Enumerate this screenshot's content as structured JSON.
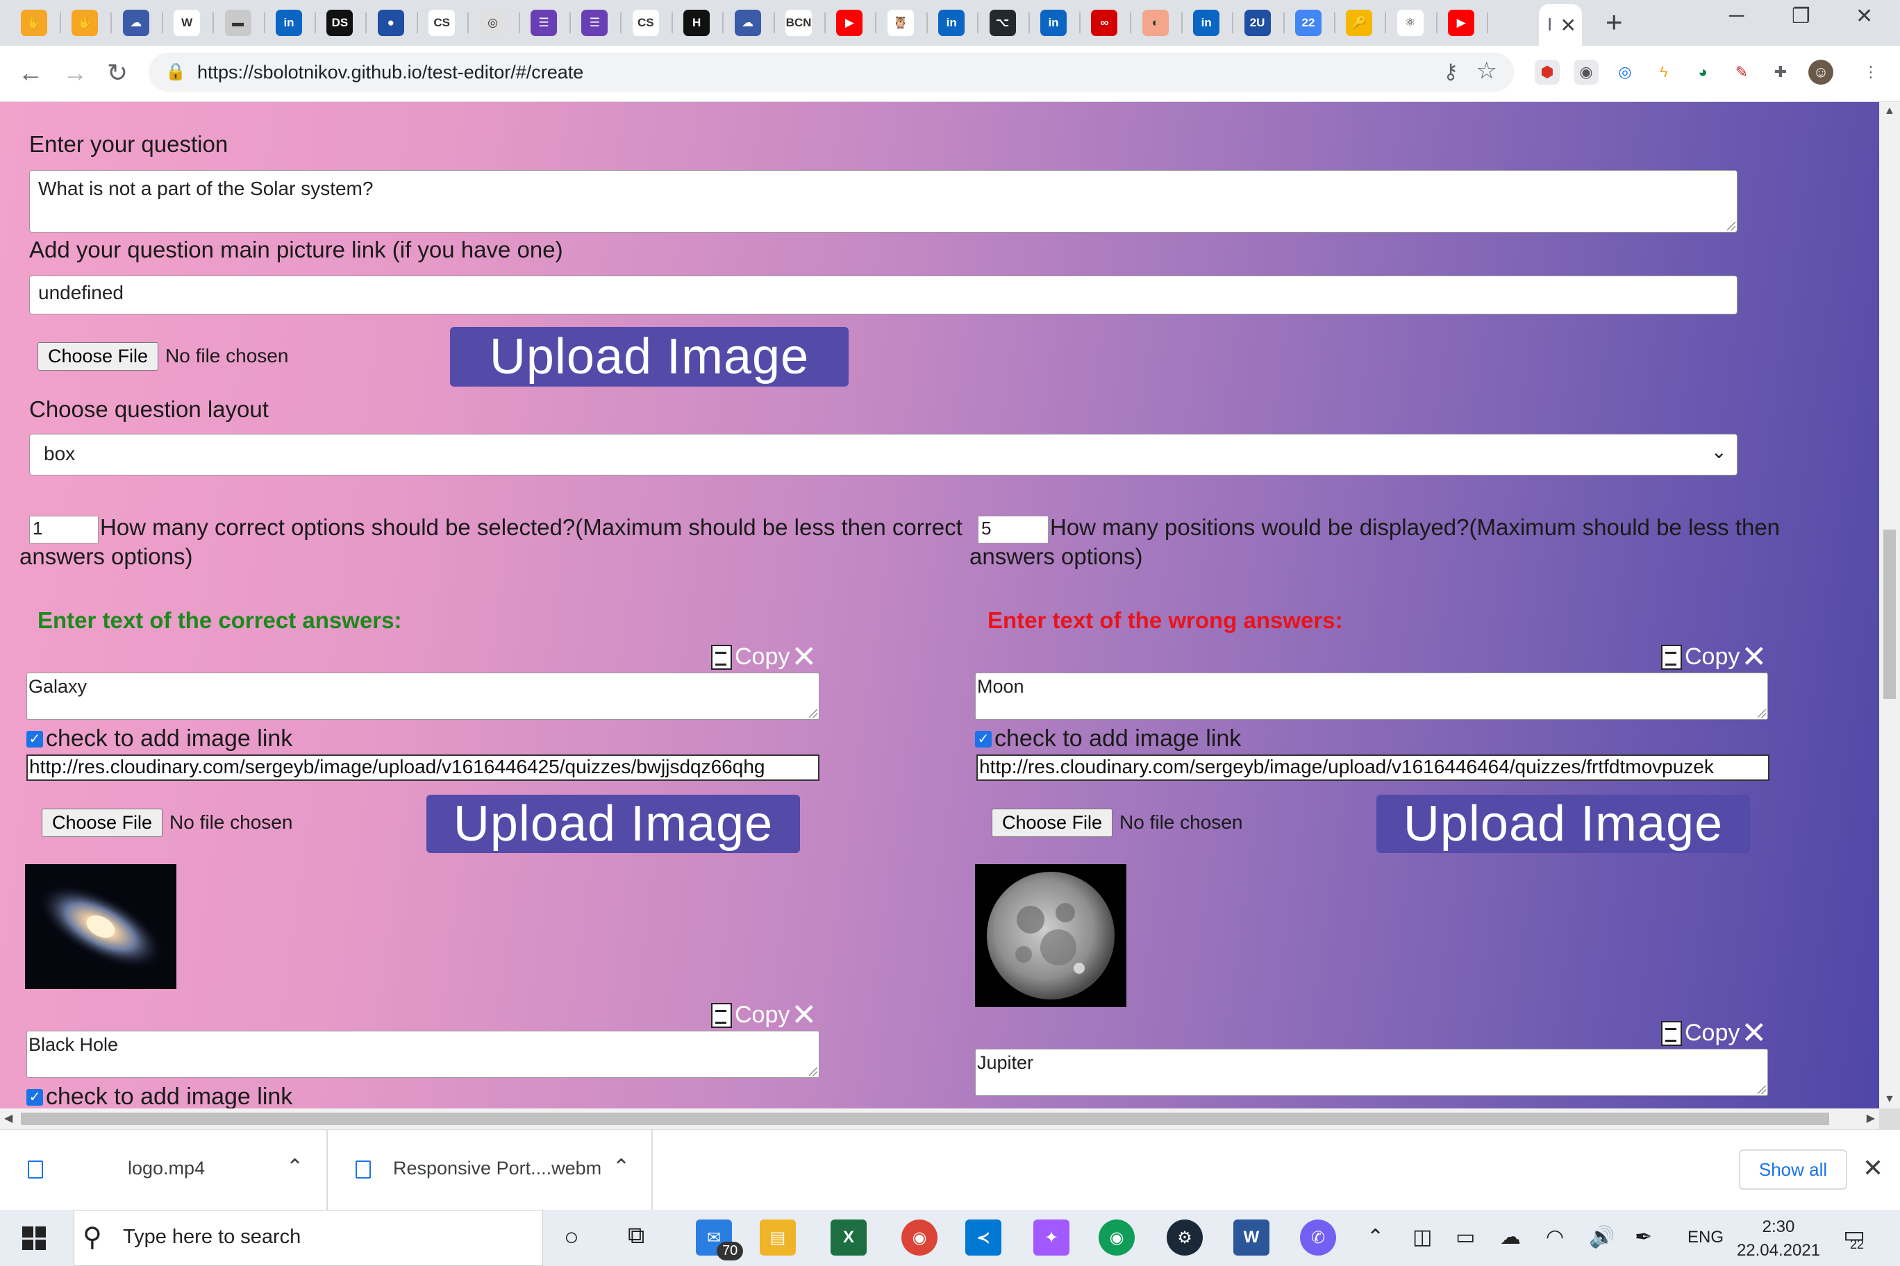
{
  "browser": {
    "tab_icons": [
      {
        "icon": "hand-icon",
        "color": "#f5a623",
        "text": "✋"
      },
      {
        "icon": "hand-icon",
        "color": "#f5a623",
        "text": "✋"
      },
      {
        "icon": "cloud-icon",
        "color": "#3b5ba9",
        "text": "☁"
      },
      {
        "icon": "wikipedia-icon",
        "color": "#ffffff",
        "text": "W"
      },
      {
        "icon": "page-icon",
        "color": "#c9c9c9",
        "text": "▬"
      },
      {
        "icon": "linkedin-icon",
        "color": "#0a66c2",
        "text": "in"
      },
      {
        "icon": "ds-icon",
        "color": "#111111",
        "text": "DS"
      },
      {
        "icon": "circle-icon",
        "color": "#1f4ea3",
        "text": "●"
      },
      {
        "icon": "cs-icon",
        "color": "#ffffff",
        "text": "CS"
      },
      {
        "icon": "badge-icon",
        "color": "#e0e0e0",
        "text": "◎"
      },
      {
        "icon": "list-icon",
        "color": "#6a3fb5",
        "text": "☰"
      },
      {
        "icon": "list-icon",
        "color": "#6a3fb5",
        "text": "☰"
      },
      {
        "icon": "cs-icon",
        "color": "#ffffff",
        "text": "CS"
      },
      {
        "icon": "h-icon",
        "color": "#111111",
        "text": "H"
      },
      {
        "icon": "cloud-icon",
        "color": "#3b5ba9",
        "text": "☁"
      },
      {
        "icon": "bcn-icon",
        "color": "#ffffff",
        "text": "BCN"
      },
      {
        "icon": "youtube-icon",
        "color": "#ff0000",
        "text": "▶"
      },
      {
        "icon": "owl-icon",
        "color": "#ffffff",
        "text": "🦉"
      },
      {
        "icon": "linkedin-icon",
        "color": "#0a66c2",
        "text": "in"
      },
      {
        "icon": "github-icon",
        "color": "#24292e",
        "text": "⌥"
      },
      {
        "icon": "linkedin-icon",
        "color": "#0a66c2",
        "text": "in"
      },
      {
        "icon": "codewars-icon",
        "color": "#d40000",
        "text": "∞"
      },
      {
        "icon": "app-icon",
        "color": "#f4a58a",
        "text": "◐"
      },
      {
        "icon": "linkedin-icon",
        "color": "#0a66c2",
        "text": "in"
      },
      {
        "icon": "2u-icon",
        "color": "#1f4ea3",
        "text": "2U"
      },
      {
        "icon": "calendar-icon",
        "color": "#4285f4",
        "text": "22"
      },
      {
        "icon": "key-icon",
        "color": "#f5b700",
        "text": "🔑"
      },
      {
        "icon": "react-icon",
        "color": "#ffffff",
        "text": "⚛"
      },
      {
        "icon": "youtube-icon",
        "color": "#ff0000",
        "text": "▶"
      }
    ],
    "active_tab_text": "I",
    "url": "https://sbolotnikov.github.io/test-editor/#/create"
  },
  "form": {
    "question_label": "Enter your question",
    "question_value": "What is not a part of the Solar system?",
    "picture_label": "Add your question main picture link (if you have one)",
    "picture_value": "undefined",
    "choose_file": "Choose File",
    "no_file": "No file chosen",
    "upload_label": "Upload Image",
    "layout_label": "Choose question layout",
    "layout_value": "box",
    "correct_count": "1",
    "correct_count_text": "How many correct options should be selected?(Maximum should be less then correct answers options)",
    "positions_count": "5",
    "positions_count_text": "How many positions would be displayed?(Maximum should be less then answers options)"
  },
  "correct": {
    "heading": "Enter text of the correct answers:",
    "heading_color": "#1a8a1a",
    "copy_label": "Copy",
    "answers": [
      {
        "text": "Galaxy",
        "checkbox_label": "check to add image link",
        "link": "http://res.cloudinary.com/sergeyb/image/upload/v1616446425/quizzes/bwjjsdqz66qhg"
      },
      {
        "text": "Black Hole",
        "checkbox_label": "check to add image link"
      }
    ]
  },
  "wrong": {
    "heading": "Enter text of the wrong answers:",
    "heading_color": "#e8141c",
    "copy_label": "Copy",
    "answers": [
      {
        "text": "Moon",
        "checkbox_label": "check to add image link",
        "link": "http://res.cloudinary.com/sergeyb/image/upload/v1616446464/quizzes/frtfdtmovpuzek"
      },
      {
        "text": "Jupiter"
      }
    ]
  },
  "downloads": {
    "items": [
      "logo.mp4",
      "Responsive Port....webm"
    ],
    "show_all": "Show all"
  },
  "taskbar": {
    "search_placeholder": "Type here to search",
    "mail_badge": "70",
    "language": "ENG",
    "time": "2:30",
    "date": "22.04.2021",
    "notif_count": "22"
  }
}
